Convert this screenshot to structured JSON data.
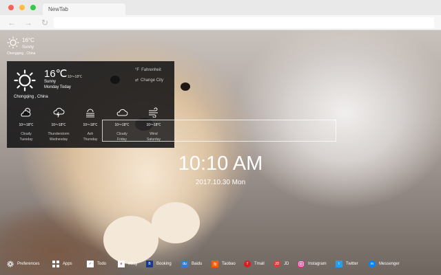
{
  "browser": {
    "tab_title": "NewTab"
  },
  "weather_mini": {
    "temp": "16°C",
    "condition": "Sunny",
    "location": "Chongqing , China"
  },
  "weather_panel": {
    "temp": "16℃",
    "range": "10～18℃",
    "condition": "Sunny",
    "day": "Monday Today",
    "unit_option": "Fahrenheit",
    "change_city": "Change City",
    "city": "Chongqing , China",
    "forecast": [
      {
        "icon": "cloudy-sun-icon",
        "range": "10～18℃",
        "name": "Cloudy",
        "day": "Tuesday"
      },
      {
        "icon": "thunderstorm-icon",
        "range": "10～18℃",
        "name": "Thunderstorm",
        "day": "Wednesday"
      },
      {
        "icon": "ash-icon",
        "range": "10～18℃",
        "name": "Ash",
        "day": "Thursday"
      },
      {
        "icon": "cloud-icon",
        "range": "10～18℃",
        "name": "Cloudy",
        "day": "Friday"
      },
      {
        "icon": "wind-icon",
        "range": "10～18℃",
        "name": "Wind",
        "day": "Saturday"
      }
    ]
  },
  "clock": {
    "time": "10:10 AM",
    "date": "2017.10.30 Mon"
  },
  "bottom_bar": {
    "preferences": "Preferences",
    "apps": "Apps",
    "todo": "Todo",
    "links": [
      {
        "label": "eBay",
        "icon": "ebay-icon",
        "color": "#ffffff"
      },
      {
        "label": "Booking",
        "icon": "booking-icon",
        "color": "#1c3a8a"
      },
      {
        "label": "Baidu",
        "icon": "baidu-icon",
        "color": "#2f7de1"
      },
      {
        "label": "Taobao",
        "icon": "taobao-icon",
        "color": "#ff5a00"
      },
      {
        "label": "Tmall",
        "icon": "tmall-icon",
        "color": "#d71e24"
      },
      {
        "label": "JD",
        "icon": "jd-icon",
        "color": "#e4393c"
      },
      {
        "label": "Instagram",
        "icon": "instagram-icon",
        "color": "#d6317f"
      },
      {
        "label": "Twitter",
        "icon": "twitter-icon",
        "color": "#1da1f2"
      },
      {
        "label": "Messenger",
        "icon": "messenger-icon",
        "color": "#0084ff"
      }
    ]
  }
}
